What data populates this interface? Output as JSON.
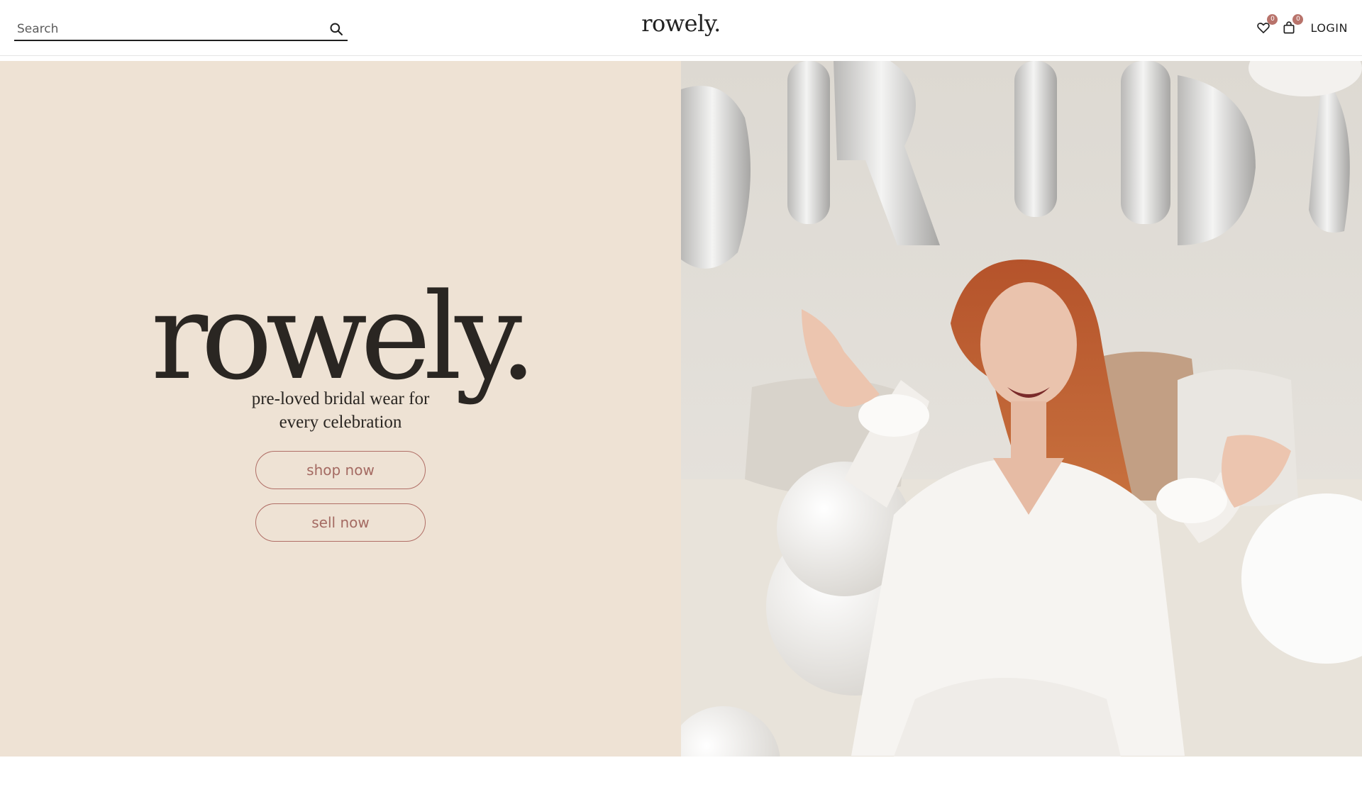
{
  "header": {
    "search_placeholder": "Search",
    "brand": "rowely.",
    "wishlist_count": "0",
    "cart_count": "0",
    "login_label": "LOGIN"
  },
  "hero": {
    "logo": "rowely.",
    "tagline_line1": "pre-loved bridal wear for",
    "tagline_line2": "every celebration",
    "shop_label": "shop now",
    "sell_label": "sell now"
  },
  "colors": {
    "hero_bg": "#eee2d4",
    "accent": "#b06e66",
    "text_dark": "#2a2622",
    "badge": "#b8736b"
  },
  "icons": [
    "search-icon",
    "heart-icon",
    "shopping-bag-icon"
  ]
}
